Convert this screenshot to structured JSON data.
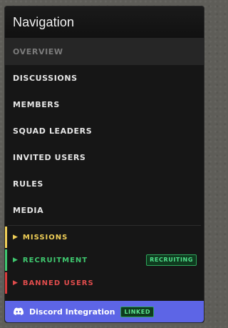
{
  "header": {
    "title": "Navigation"
  },
  "nav": {
    "items": [
      {
        "label": "OVERVIEW",
        "active": true
      },
      {
        "label": "DISCUSSIONS",
        "active": false
      },
      {
        "label": "MEMBERS",
        "active": false
      },
      {
        "label": "SQUAD LEADERS",
        "active": false
      },
      {
        "label": "INVITED USERS",
        "active": false
      },
      {
        "label": "RULES",
        "active": false
      },
      {
        "label": "MEDIA",
        "active": false
      }
    ]
  },
  "sections": {
    "missions": {
      "label": "MISSIONS",
      "arrow": "▶",
      "color": "#f0cf57"
    },
    "recruitment": {
      "label": "RECRUITMENT",
      "arrow": "▶",
      "color": "#3fc86f",
      "badge": "RECRUITING"
    },
    "banned": {
      "label": "BANNED USERS",
      "arrow": "▶",
      "color": "#e04c4c"
    }
  },
  "discord": {
    "label": "Discord Integration",
    "status": "LINKED",
    "icon": "discord-icon",
    "color": "#5d65e6"
  }
}
